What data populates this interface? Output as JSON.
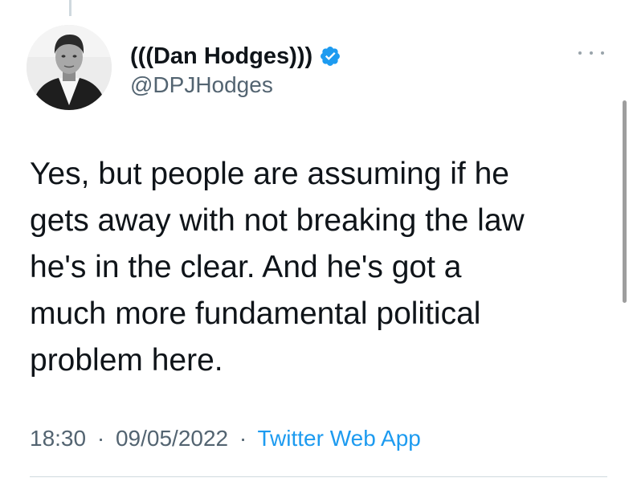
{
  "author": {
    "display_name": "(((Dan Hodges)))",
    "handle": "@DPJHodges",
    "verified": true,
    "avatar_icon": "profile-photo"
  },
  "tweet": {
    "lines": [
      "Yes, but people are assuming if he",
      "gets away with not breaking the law",
      "he's in the clear. And he's got a",
      "much more fundamental political",
      "problem here."
    ]
  },
  "meta": {
    "time": "18:30",
    "date": "09/05/2022",
    "separator": "·",
    "source": "Twitter Web App"
  },
  "icons": {
    "verified": "verified-badge-icon",
    "more": "more-options-icon"
  },
  "colors": {
    "text": "#0f1419",
    "secondary": "#536471",
    "link": "#1d9bf0",
    "verified": "#1d9bf0"
  }
}
